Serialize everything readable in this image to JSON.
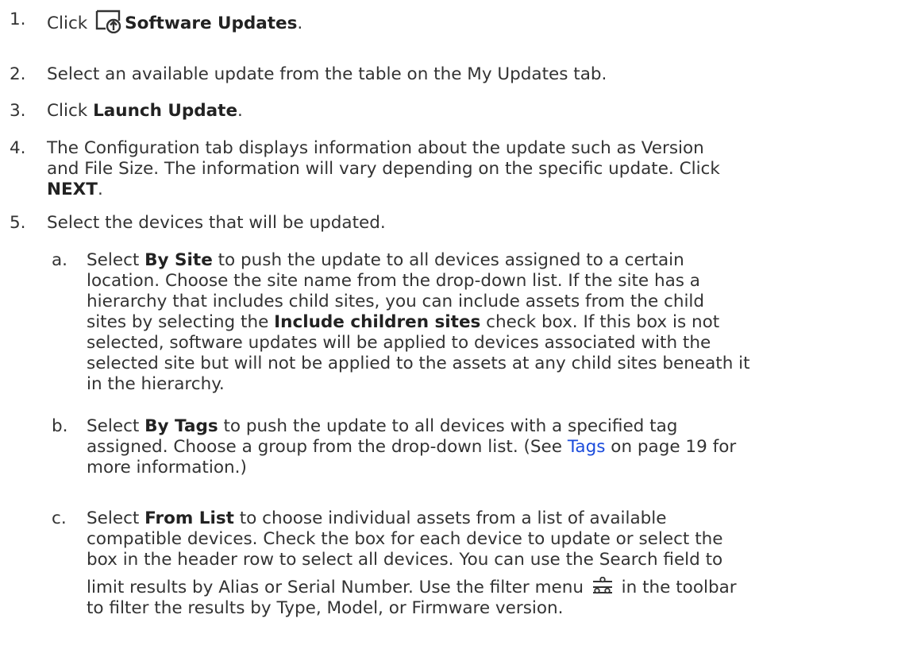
{
  "steps": {
    "s1": {
      "num": "1.",
      "pre": "Click ",
      "bold": "Software Updates",
      "post": ".",
      "icon": "software-update-icon"
    },
    "s2": {
      "num": "2.",
      "text": "Select an available update from the table on the My Updates tab."
    },
    "s3": {
      "num": "3.",
      "pre": "Click ",
      "bold": "Launch Update",
      "post": "."
    },
    "s4": {
      "num": "4.",
      "line1": "The Configuration tab displays information about the update such as Version",
      "line2": "and File Size. The information will vary depending on the specific update. Click",
      "bold": "NEXT",
      "post": "."
    },
    "s5": {
      "num": "5.",
      "text": "Select the devices that will be updated."
    }
  },
  "substeps": {
    "a": {
      "letter": "a.",
      "l1_pre": "Select ",
      "l1_bold": "By Site",
      "l1_post": " to push the update to all devices assigned to a certain",
      "l2": "location. Choose the site name from the drop-down list. If the site has a",
      "l3": "hierarchy that includes child sites, you can include assets from the child",
      "l4_pre": "sites by selecting the ",
      "l4_bold": "Include children sites",
      "l4_post": " check box. If this box is not",
      "l5": "selected, software updates will be applied to devices associated with the",
      "l6": "selected site but will not be applied to the assets at any child sites beneath it",
      "l7": "in the hierarchy."
    },
    "b": {
      "letter": "b.",
      "l1_pre": "Select ",
      "l1_bold": "By Tags",
      "l1_post": " to push the update to all devices with a specified tag",
      "l2_pre": "assigned. Choose a group from the drop-down list. (See ",
      "l2_link": "Tags",
      "l2_post": " on page 19 for",
      "l3": "more information.)"
    },
    "c": {
      "letter": "c.",
      "l1_pre": "Select ",
      "l1_bold": "From List",
      "l1_post": " to choose individual assets from a list of available",
      "l2": "compatible devices. Check the box for each device to update or select the",
      "l3": "box in the header row to select all devices. You can use the Search field to",
      "l4_pre": "limit results by Alias or Serial Number. Use the filter menu ",
      "l4_post": " in the toolbar",
      "l5": "to filter the results by Type, Model, or Firmware version.",
      "icon": "filter-icon"
    }
  }
}
